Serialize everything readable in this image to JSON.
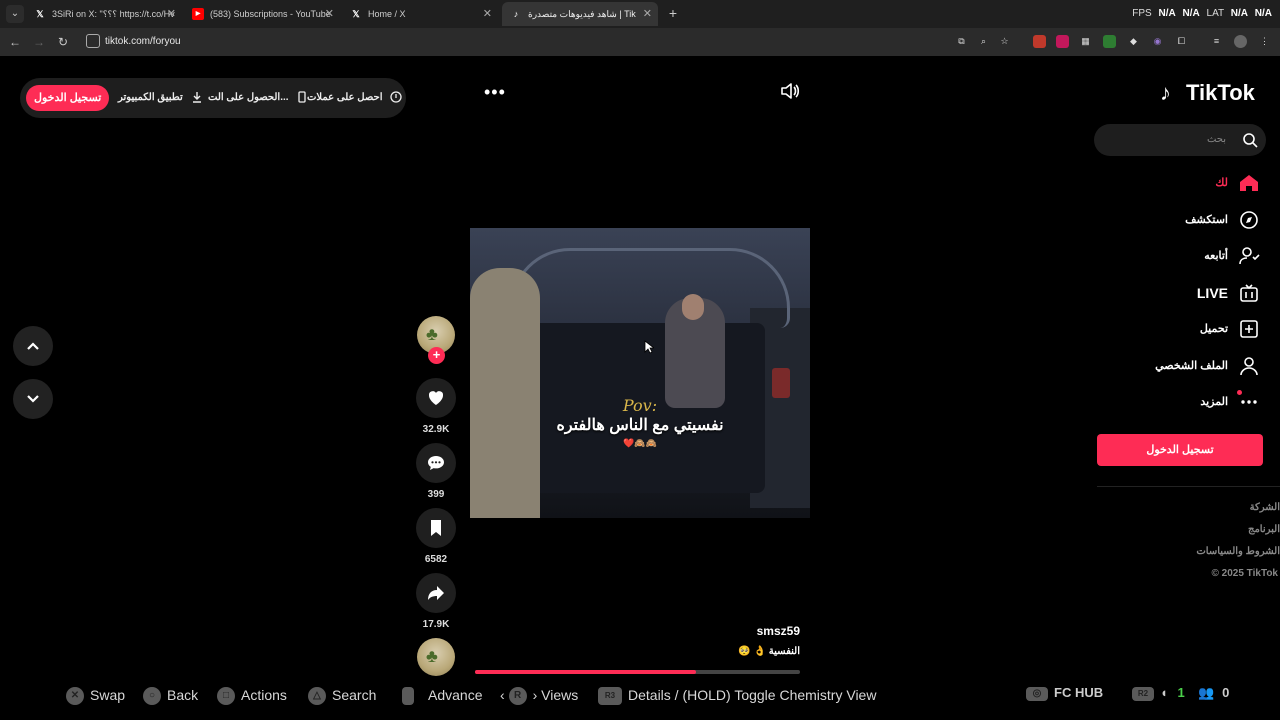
{
  "browser": {
    "tabs": [
      {
        "title": "3SiRi on X: \"؟؟؟ https://t.co/Hv",
        "icon": "x-logo-icon",
        "active": false
      },
      {
        "title": "(583) Subscriptions - YouTube",
        "icon": "youtube-icon",
        "active": false
      },
      {
        "title": "Home / X",
        "icon": "x-logo-icon",
        "active": false
      },
      {
        "title": "شاهد فيديوهات متصدرة | Tik",
        "icon": "tiktok-icon",
        "active": true
      }
    ],
    "fps_overlay": {
      "fps_label": "FPS",
      "fps_value": "N/A",
      "value2": "N/A",
      "lat_label": "LAT",
      "lat_value": "N/A",
      "value4": "N/A"
    },
    "address": "tiktok.com/foryou"
  },
  "topbar": {
    "login_button": "تسجيل الدخول",
    "desktop_app": "تطبيق الكمبيوتر",
    "get_app": "الحصول على الت...",
    "get_coins": "احصل على عملات"
  },
  "video": {
    "overlay_pov": "Pov:",
    "overlay_caption": "نفسيتي مع الناس هالفتره",
    "overlay_emoji": "❤️🙈🙈",
    "author": "smsz59",
    "description": "🥺 👌 النفسية",
    "progress": 0.68
  },
  "actions": {
    "likes": "32.9K",
    "comments": "399",
    "saves": "6582",
    "shares": "17.9K"
  },
  "sidebar": {
    "brand": "TikTok",
    "search_placeholder": "بحث",
    "nav": [
      {
        "label": "لك",
        "icon": "home-icon",
        "active": true
      },
      {
        "label": "استكشف",
        "icon": "compass-icon",
        "active": false
      },
      {
        "label": "أتابعه",
        "icon": "user-follow-icon",
        "active": false
      },
      {
        "label": "LIVE",
        "icon": "live-tv-icon",
        "active": false
      },
      {
        "label": "تحميل",
        "icon": "upload-plus-icon",
        "active": false
      },
      {
        "label": "الملف الشخصي",
        "icon": "profile-icon",
        "active": false
      },
      {
        "label": "المزيد",
        "icon": "more-dots-icon",
        "active": false
      }
    ],
    "login_button": "تسجيل الدخول",
    "footer": [
      "الشركة",
      "البرنامج",
      "الشروط والسياسات"
    ],
    "copyright": "© 2025 TikTok"
  },
  "controller_hints": {
    "swap": "Swap",
    "back": "Back",
    "actions": "Actions",
    "search": "Search",
    "advance": "Advance",
    "views": "Views",
    "views_key": "R",
    "details": "Details / (HOLD) Toggle Chemistry View",
    "details_key": "R3",
    "fc_hub": "FC HUB",
    "r2_key": "R2",
    "count_green": "1",
    "count_white": "0"
  },
  "colors": {
    "accent": "#fe2c55",
    "background": "#000000",
    "panel": "#1e1e1e"
  }
}
